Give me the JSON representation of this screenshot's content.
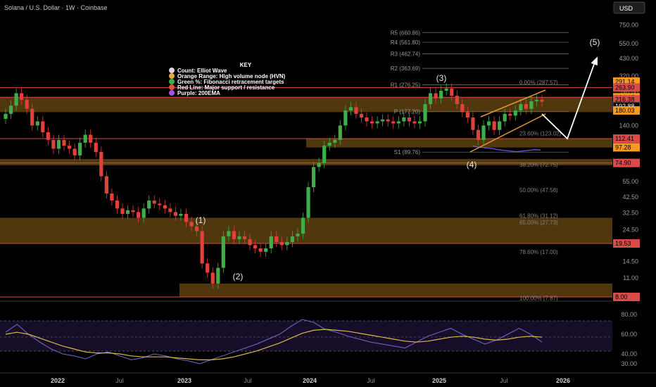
{
  "header": {
    "title": "Solana / U.S. Dollar · 1W · Coinbase"
  },
  "currency_button": "USD",
  "key": {
    "title": "KEY",
    "items": [
      {
        "label": "Count: Elliot Wave",
        "color": "#d9d9d9"
      },
      {
        "label": "Orange Range: High volume node (HVN)",
        "color": "#e8a640"
      },
      {
        "label": "Green %: Fibonacci retracement targets",
        "color": "#3fae49"
      },
      {
        "label": "Red Line: Major support / resistance",
        "color": "#e0513a"
      },
      {
        "label": "Purple: 200EMA",
        "color": "#a650e8"
      }
    ]
  },
  "colors": {
    "background": "#000000",
    "up_candle": "#3fae49",
    "down_candle": "#e0413a",
    "hvn_zone": "#6b4a12",
    "support_line": "#d94a4a",
    "ema200": "#7b55d6",
    "rsi": "#7768c8",
    "rsi_ma": "#d8b84a",
    "channel": "#e39a2a",
    "projection": "#ffffff"
  },
  "chart_data": [
    {
      "type": "line",
      "title": "Solana / U.S. Dollar · 1W · Coinbase",
      "scale": "log",
      "ylim": [
        7,
        1000
      ],
      "x_ticks": [
        "2022",
        "Jul",
        "2023",
        "Jul",
        "2024",
        "Jul",
        "2025",
        "Jul",
        "2026"
      ],
      "y_ticks": [
        "1,000.00",
        "750.00",
        "550.00",
        "430.00",
        "320.00",
        "240.00",
        "180.00",
        "140.00",
        "100.00",
        "75.00",
        "55.00",
        "42.50",
        "32.50",
        "24.50",
        "19.00",
        "14.50",
        "11.00",
        "8.00"
      ],
      "series": [
        {
          "values": [
            170,
            195,
            240,
            215,
            185,
            140,
            150,
            125,
            110,
            95,
            110,
            100,
            95,
            85,
            105,
            120,
            105,
            90,
            60,
            45,
            40,
            35,
            32,
            34,
            33,
            30,
            35,
            40,
            38,
            37,
            35,
            33,
            31,
            32,
            28,
            26,
            24,
            14,
            12,
            10,
            13,
            22,
            24,
            21,
            22,
            21,
            19,
            18,
            17,
            18,
            22,
            20,
            19,
            20,
            22,
            23,
            30,
            50,
            70,
            75,
            100,
            105,
            110,
            140,
            180,
            190,
            170,
            160,
            150,
            145,
            150,
            155,
            150,
            145,
            150,
            160,
            150,
            145,
            150,
            200,
            240,
            220,
            250,
            260,
            230,
            200,
            175,
            160,
            130,
            110,
            140,
            150,
            130,
            150,
            170,
            165,
            180,
            200,
            185,
            210,
            215,
            208
          ]
        }
      ],
      "ema200": [
        120,
        118,
        117,
        116,
        115,
        113,
        112,
        111,
        110,
        109,
        110,
        111,
        112,
        113,
        112
      ],
      "support_resistance": [
        "263.90",
        "224.17",
        "112.41",
        "74.90",
        "19.53",
        "8.00"
      ],
      "hvn_zones": [
        {
          "low": 175,
          "high": 224
        },
        {
          "low": 97,
          "high": 112
        },
        {
          "low": 72,
          "high": 80
        },
        {
          "low": 19.5,
          "high": 30
        },
        {
          "low": 8,
          "high": 10
        }
      ],
      "pivots": [
        {
          "label": "R5 (660.86)",
          "value": 660.86
        },
        {
          "label": "R4 (561.80)",
          "value": 561.8
        },
        {
          "label": "R3 (462.74)",
          "value": 462.74
        },
        {
          "label": "R2 (363.69)",
          "value": 363.69
        },
        {
          "label": "R1 (276.25)",
          "value": 276.25
        },
        {
          "label": "P (177.20)",
          "value": 177.2
        },
        {
          "label": "S1 (89.76)",
          "value": 89.76
        }
      ],
      "fibonacci": [
        {
          "label": "0.00% (287.57)",
          "value": 287.57
        },
        {
          "label": "23.60% (123.02)",
          "value": 123.02
        },
        {
          "label": "38.20% (72.75)",
          "value": 72.75
        },
        {
          "label": "50.00% (47.58)",
          "value": 47.58
        },
        {
          "label": "61.80% (31.12)",
          "value": 31.12
        },
        {
          "label": "65.00% (27.73)",
          "value": 27.73
        },
        {
          "label": "78.60% (17.00)",
          "value": 17.0
        },
        {
          "label": "100.00% (7.87)",
          "value": 7.87
        }
      ],
      "price_labels": [
        {
          "text": "291.14",
          "value": 291.14,
          "color": "#f59a23"
        },
        {
          "text": "263.90",
          "value": 263.9,
          "color": "#d94a4a"
        },
        {
          "text": "224.17",
          "value": 224.17,
          "color": "#f59a23"
        },
        {
          "text": "216.38",
          "value": 216.38,
          "color": "#d94a4a"
        },
        {
          "text": "192.88",
          "value": 192.88,
          "color": "#000000"
        },
        {
          "text": "180.03",
          "value": 180.03,
          "color": "#f59a23"
        },
        {
          "text": "112.41",
          "value": 112.41,
          "color": "#d94a4a"
        },
        {
          "text": "97.28",
          "value": 97.28,
          "color": "#f59a23"
        },
        {
          "text": "74.90",
          "value": 74.9,
          "color": "#d94a4a"
        },
        {
          "text": "19.53",
          "value": 19.53,
          "color": "#d94a4a"
        },
        {
          "text": "8.00",
          "value": 8.0,
          "color": "#d94a4a"
        }
      ],
      "wave_labels": [
        "(1)",
        "(2)",
        "(3)",
        "(4)",
        "(5)"
      ]
    },
    {
      "type": "line",
      "title": "",
      "ylim": [
        25,
        85
      ],
      "y_ticks": [
        "80.00",
        "60.00",
        "40.00",
        "30.00"
      ],
      "series": [
        {
          "values": [
            62,
            70,
            60,
            52,
            45,
            40,
            38,
            35,
            40,
            42,
            38,
            34,
            36,
            40,
            38,
            35,
            33,
            30,
            34,
            38,
            42,
            46,
            50,
            55,
            60,
            68,
            75,
            72,
            65,
            62,
            58,
            55,
            52,
            50,
            48,
            46,
            52,
            58,
            62,
            66,
            60,
            55,
            50,
            54,
            60,
            66,
            60,
            52
          ]
        },
        {
          "values": [
            60,
            62,
            60,
            56,
            52,
            48,
            45,
            42,
            41,
            41,
            40,
            38,
            37,
            37,
            37,
            36,
            35,
            34,
            34,
            35,
            37,
            40,
            43,
            47,
            51,
            56,
            61,
            64,
            65,
            64,
            63,
            61,
            59,
            57,
            55,
            53,
            52,
            53,
            55,
            57,
            58,
            57,
            55,
            54,
            55,
            57,
            58,
            57
          ]
        }
      ]
    }
  ]
}
